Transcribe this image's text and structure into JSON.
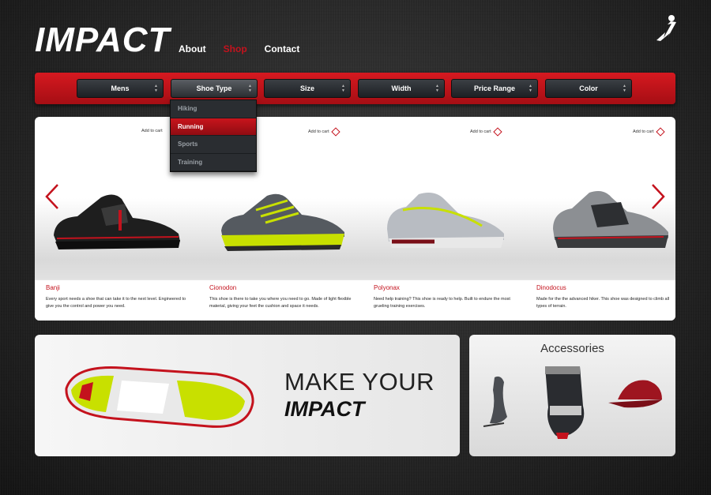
{
  "header": {
    "logo": "IMPACT",
    "nav": [
      "About",
      "Shop",
      "Contact"
    ],
    "active_nav": "Shop"
  },
  "filters": [
    "Mens",
    "Shoe Type",
    "Size",
    "Width",
    "Price Range",
    "Color"
  ],
  "dropdown": {
    "open_filter": "Shoe Type",
    "options": [
      "Hiking",
      "Running",
      "Sports",
      "Training"
    ],
    "selected": "Running"
  },
  "products": [
    {
      "name": "Banji",
      "add_label": "Add to cart",
      "description": "Every sport needs a shoe that can take it to the next level. Engineered to give you the control and power you need."
    },
    {
      "name": "Cionodon",
      "add_label": "Add to cart",
      "description": "This shoe is there to take you where you need to go. Made of light flexible material, giving your feet the cushion and space it needs."
    },
    {
      "name": "Polyonax",
      "add_label": "Add to cart",
      "description": "Need help training? This shoe is ready to help. Built to endure the most grueling training exercises."
    },
    {
      "name": "Dinodocus",
      "add_label": "Add to cart",
      "description": "Made for the the advanced hiker. This shoe was designed to climb all types of terrain."
    }
  ],
  "promo": {
    "line1": "MAKE YOUR",
    "line2": "IMPACT"
  },
  "accessories": {
    "title": "Accessories"
  },
  "colors": {
    "accent": "#c4121d",
    "lime": "#c8e000",
    "dark": "#1d2024"
  },
  "icons": [
    "brand-logo-icon",
    "chevron-left-icon",
    "chevron-right-icon",
    "diamond-icon",
    "sort-arrows-icon"
  ]
}
